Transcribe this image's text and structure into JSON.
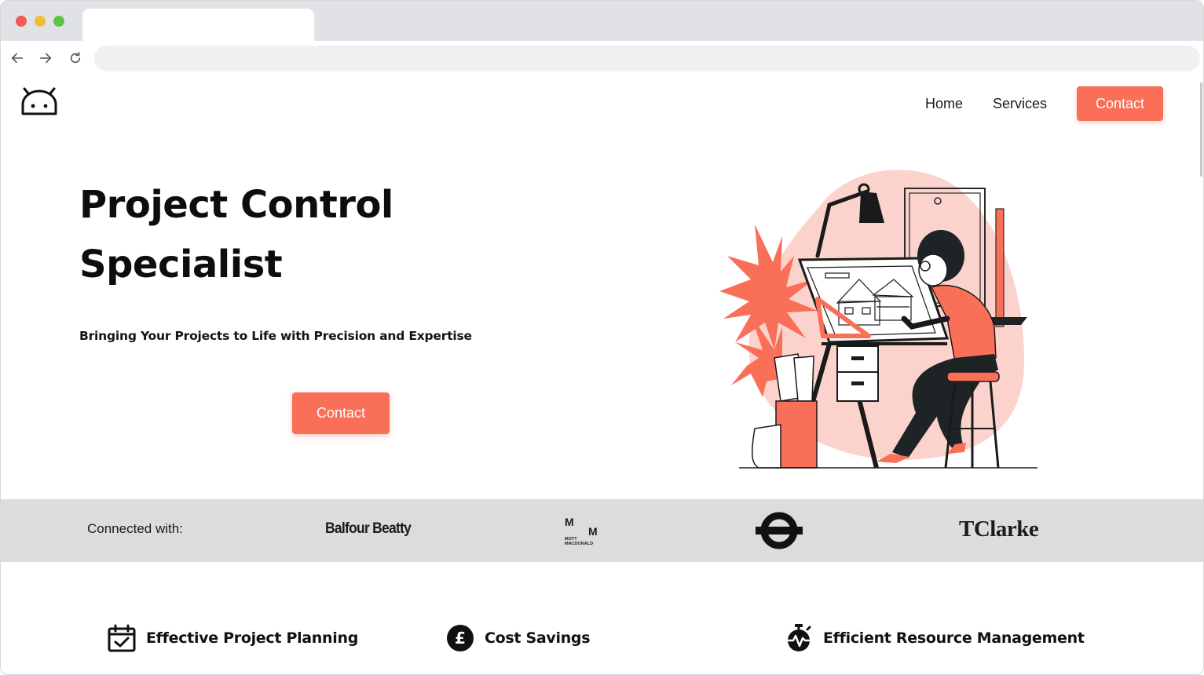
{
  "browser": {
    "tab_title": "",
    "url": ""
  },
  "header": {
    "logo_icon": "android-face-icon",
    "nav": {
      "home_label": "Home",
      "services_label": "Services",
      "contact_label": "Contact"
    }
  },
  "hero": {
    "title_line1": "Project Control",
    "title_line2": "Specialist",
    "subtitle": "Bringing Your Projects to Life with Precision and Expertise",
    "cta_label": "Contact",
    "illustration": "architect-drafting-illustration"
  },
  "connected": {
    "label": "Connected with:",
    "partners": [
      {
        "name": "Balfour Beatty",
        "kind": "wordmark"
      },
      {
        "name": "Mott MacDonald",
        "kind": "logo",
        "mark_top": "M",
        "mark_right": "M",
        "mark_small_1": "MOTT",
        "mark_small_2": "MACDONALD"
      },
      {
        "name": "Transport for London",
        "kind": "roundel-logo"
      },
      {
        "name": "TClarke",
        "kind": "wordmark"
      }
    ]
  },
  "features": [
    {
      "icon": "calendar-check-icon",
      "label": "Effective Project Planning"
    },
    {
      "icon": "pound-coin-icon",
      "label": "Cost Savings"
    },
    {
      "icon": "stopwatch-pulse-icon",
      "label": "Efficient Resource Management"
    }
  ],
  "colors": {
    "accent": "#fa6f58",
    "band": "#dcdcdc",
    "illustration_blob": "#fbd3cc",
    "ink": "#111111"
  }
}
